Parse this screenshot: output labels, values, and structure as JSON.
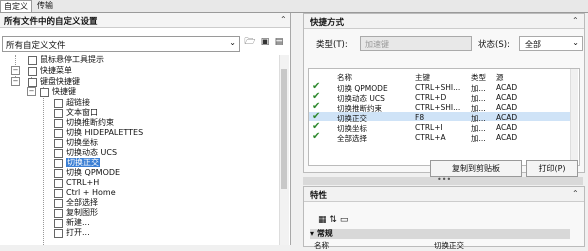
{
  "tabs": [
    "自定义",
    "传输"
  ],
  "left_panel": {
    "title": "所有文件中的自定义设置",
    "combo_value": "所有自定义文件",
    "tree": [
      {
        "label": "鼠标悬停工具提示",
        "depth": 2
      },
      {
        "label": "快捷菜单",
        "depth": 2
      },
      {
        "label": "键盘快捷键",
        "depth": 2
      },
      {
        "label": "快捷键",
        "depth": 3
      },
      {
        "label": "超链接",
        "depth": 4
      },
      {
        "label": "文本窗口",
        "depth": 4
      },
      {
        "label": "切换推断约束",
        "depth": 4
      },
      {
        "label": "切换 HIDEPALETTES",
        "depth": 4
      },
      {
        "label": "切换坐标",
        "depth": 4
      },
      {
        "label": "切换动态 UCS",
        "depth": 4
      },
      {
        "label": "切换正交",
        "depth": 4,
        "selected": true
      },
      {
        "label": "切换 QPMODE",
        "depth": 4
      },
      {
        "label": "CTRL+H",
        "depth": 4
      },
      {
        "label": "Ctrl + Home",
        "depth": 4
      },
      {
        "label": "全部选择",
        "depth": 4
      },
      {
        "label": "复制图形",
        "depth": 4
      },
      {
        "label": "新建...",
        "depth": 4
      },
      {
        "label": "打开...",
        "depth": 4
      }
    ]
  },
  "shortcuts_panel": {
    "title": "快捷方式",
    "type_label": "类型(T):",
    "type_placeholder": "加速键",
    "status_label": "状态(S):",
    "status_value": "全部",
    "columns": [
      "名称",
      "主键",
      "类型",
      "源"
    ],
    "rows": [
      {
        "name": "切换 QPMODE",
        "key": "CTRL+SHI...",
        "type": "加...",
        "src": "ACAD"
      },
      {
        "name": "切换动态 UCS",
        "key": "CTRL+D",
        "type": "加...",
        "src": "ACAD"
      },
      {
        "name": "切换推断约束",
        "key": "CTRL+SHI...",
        "type": "加...",
        "src": "ACAD"
      },
      {
        "name": "切换正交",
        "key": "F8",
        "type": "加...",
        "src": "ACAD",
        "highlight": true
      },
      {
        "name": "切换坐标",
        "key": "CTRL+I",
        "type": "加...",
        "src": "ACAD"
      },
      {
        "name": "全部选择",
        "key": "CTRL+A",
        "type": "加...",
        "src": "ACAD"
      }
    ],
    "copy_button": "复制到剪贴板",
    "print_button": "打印(P)"
  },
  "properties_panel": {
    "title": "特性",
    "group": "常规",
    "prop_name": "名称",
    "prop_value": "切换正交"
  },
  "colors": {
    "selection": "#3b7fd4",
    "check": "#2f8a2f"
  }
}
